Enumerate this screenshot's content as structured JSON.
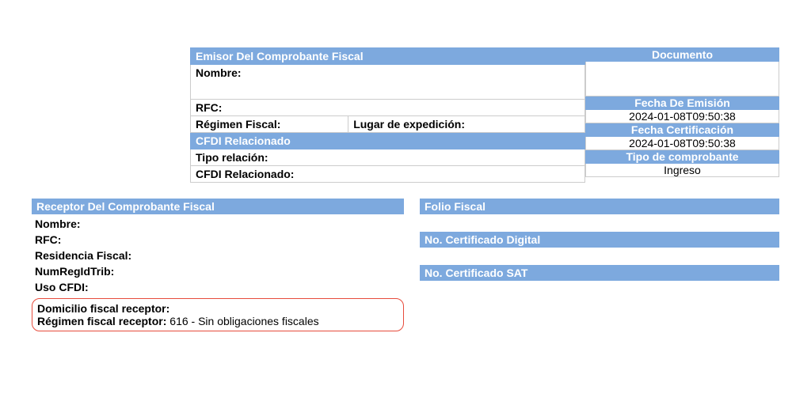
{
  "emisor": {
    "header": "Emisor Del Comprobante Fiscal",
    "nombre_label": "Nombre:",
    "nombre_value": "",
    "rfc_label": "RFC:",
    "rfc_value": "",
    "regimen_label": "Régimen Fiscal:",
    "lugar_label": "Lugar de expedición:",
    "cfdi_rel_header": "CFDI Relacionado",
    "tipo_relacion_label": "Tipo relación:",
    "tipo_relacion_value": "",
    "cfdi_rel_label": "CFDI Relacionado:",
    "cfdi_rel_value": ""
  },
  "documento": {
    "header": "Documento",
    "blank": "",
    "fecha_emision_header": "Fecha De Emisión",
    "fecha_emision_value": "2024-01-08T09:50:38",
    "fecha_cert_header": "Fecha Certificación",
    "fecha_cert_value": "2024-01-08T09:50:38",
    "tipo_comp_header": "Tipo de comprobante",
    "tipo_comp_value": "Ingreso"
  },
  "receptor": {
    "header": "Receptor Del Comprobante Fiscal",
    "nombre_label": "Nombre:",
    "rfc_label": "RFC:",
    "residencia_label": "Residencia Fiscal:",
    "numreg_label": "NumRegIdTrib:",
    "uso_label": "Uso CFDI:",
    "domicilio_label": "Domicilio fiscal receptor:",
    "regimen_label": "Régimen fiscal receptor: ",
    "regimen_value": "616 - Sin obligaciones fiscales"
  },
  "folio": {
    "header": "Folio Fiscal",
    "cert_digital": "No. Certificado Digital",
    "cert_sat": "No. Certificado SAT"
  }
}
